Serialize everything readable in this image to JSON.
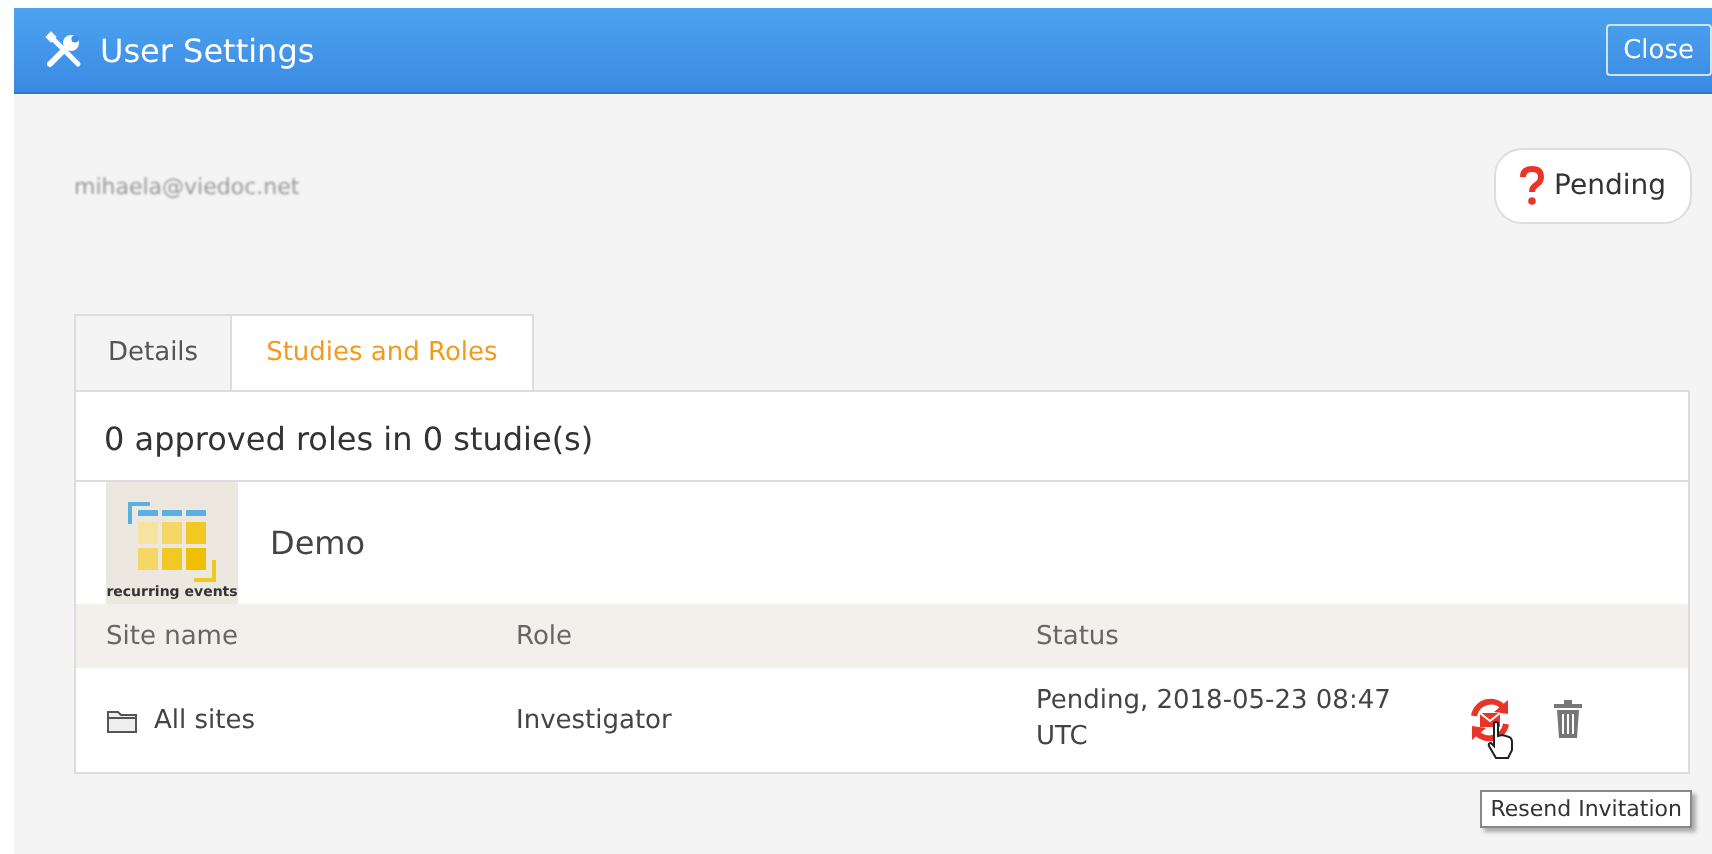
{
  "window": {
    "title": "User Settings",
    "close_button": "Close"
  },
  "user": {
    "email": "mihaela@viedoc.net",
    "status_badge": "Pending"
  },
  "tabs": [
    {
      "label": "Details",
      "selected": false
    },
    {
      "label": "Studies and Roles",
      "selected": true
    }
  ],
  "summary": "0 approved roles in 0 studie(s)",
  "study": {
    "name": "Demo",
    "thumbnail_caption": "recurring events"
  },
  "table": {
    "columns": [
      "Site name",
      "Role",
      "Status"
    ],
    "rows": [
      {
        "site": "All sites",
        "role": "Investigator",
        "status": "Pending, 2018-05-23 08:47 UTC"
      }
    ]
  },
  "tooltip": "Resend Invitation"
}
